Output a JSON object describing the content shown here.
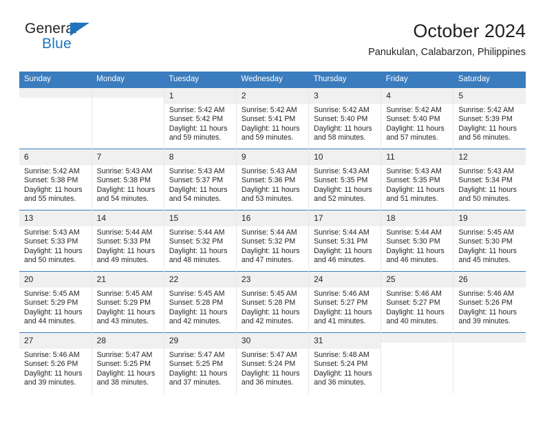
{
  "brand": {
    "name_top": "General",
    "name_bottom": "Blue",
    "triangle_color": "#1f74bd",
    "text_color": "#231f20"
  },
  "header": {
    "title": "October 2024",
    "subtitle": "Panukulan, Calabarzon, Philippines"
  },
  "calendar": {
    "header_bg": "#3a7cbe",
    "header_text_color": "#ffffff",
    "daynum_bg": "#f0f0f0",
    "weekday_headers": [
      "Sunday",
      "Monday",
      "Tuesday",
      "Wednesday",
      "Thursday",
      "Friday",
      "Saturday"
    ],
    "weeks": [
      [
        {
          "day": "",
          "sunrise": "",
          "sunset": "",
          "daylight_line1": "",
          "daylight_line2": ""
        },
        {
          "day": "",
          "sunrise": "",
          "sunset": "",
          "daylight_line1": "",
          "daylight_line2": ""
        },
        {
          "day": "1",
          "sunrise": "Sunrise: 5:42 AM",
          "sunset": "Sunset: 5:42 PM",
          "daylight_line1": "Daylight: 11 hours",
          "daylight_line2": "and 59 minutes."
        },
        {
          "day": "2",
          "sunrise": "Sunrise: 5:42 AM",
          "sunset": "Sunset: 5:41 PM",
          "daylight_line1": "Daylight: 11 hours",
          "daylight_line2": "and 59 minutes."
        },
        {
          "day": "3",
          "sunrise": "Sunrise: 5:42 AM",
          "sunset": "Sunset: 5:40 PM",
          "daylight_line1": "Daylight: 11 hours",
          "daylight_line2": "and 58 minutes."
        },
        {
          "day": "4",
          "sunrise": "Sunrise: 5:42 AM",
          "sunset": "Sunset: 5:40 PM",
          "daylight_line1": "Daylight: 11 hours",
          "daylight_line2": "and 57 minutes."
        },
        {
          "day": "5",
          "sunrise": "Sunrise: 5:42 AM",
          "sunset": "Sunset: 5:39 PM",
          "daylight_line1": "Daylight: 11 hours",
          "daylight_line2": "and 56 minutes."
        }
      ],
      [
        {
          "day": "6",
          "sunrise": "Sunrise: 5:42 AM",
          "sunset": "Sunset: 5:38 PM",
          "daylight_line1": "Daylight: 11 hours",
          "daylight_line2": "and 55 minutes."
        },
        {
          "day": "7",
          "sunrise": "Sunrise: 5:43 AM",
          "sunset": "Sunset: 5:38 PM",
          "daylight_line1": "Daylight: 11 hours",
          "daylight_line2": "and 54 minutes."
        },
        {
          "day": "8",
          "sunrise": "Sunrise: 5:43 AM",
          "sunset": "Sunset: 5:37 PM",
          "daylight_line1": "Daylight: 11 hours",
          "daylight_line2": "and 54 minutes."
        },
        {
          "day": "9",
          "sunrise": "Sunrise: 5:43 AM",
          "sunset": "Sunset: 5:36 PM",
          "daylight_line1": "Daylight: 11 hours",
          "daylight_line2": "and 53 minutes."
        },
        {
          "day": "10",
          "sunrise": "Sunrise: 5:43 AM",
          "sunset": "Sunset: 5:35 PM",
          "daylight_line1": "Daylight: 11 hours",
          "daylight_line2": "and 52 minutes."
        },
        {
          "day": "11",
          "sunrise": "Sunrise: 5:43 AM",
          "sunset": "Sunset: 5:35 PM",
          "daylight_line1": "Daylight: 11 hours",
          "daylight_line2": "and 51 minutes."
        },
        {
          "day": "12",
          "sunrise": "Sunrise: 5:43 AM",
          "sunset": "Sunset: 5:34 PM",
          "daylight_line1": "Daylight: 11 hours",
          "daylight_line2": "and 50 minutes."
        }
      ],
      [
        {
          "day": "13",
          "sunrise": "Sunrise: 5:43 AM",
          "sunset": "Sunset: 5:33 PM",
          "daylight_line1": "Daylight: 11 hours",
          "daylight_line2": "and 50 minutes."
        },
        {
          "day": "14",
          "sunrise": "Sunrise: 5:44 AM",
          "sunset": "Sunset: 5:33 PM",
          "daylight_line1": "Daylight: 11 hours",
          "daylight_line2": "and 49 minutes."
        },
        {
          "day": "15",
          "sunrise": "Sunrise: 5:44 AM",
          "sunset": "Sunset: 5:32 PM",
          "daylight_line1": "Daylight: 11 hours",
          "daylight_line2": "and 48 minutes."
        },
        {
          "day": "16",
          "sunrise": "Sunrise: 5:44 AM",
          "sunset": "Sunset: 5:32 PM",
          "daylight_line1": "Daylight: 11 hours",
          "daylight_line2": "and 47 minutes."
        },
        {
          "day": "17",
          "sunrise": "Sunrise: 5:44 AM",
          "sunset": "Sunset: 5:31 PM",
          "daylight_line1": "Daylight: 11 hours",
          "daylight_line2": "and 46 minutes."
        },
        {
          "day": "18",
          "sunrise": "Sunrise: 5:44 AM",
          "sunset": "Sunset: 5:30 PM",
          "daylight_line1": "Daylight: 11 hours",
          "daylight_line2": "and 46 minutes."
        },
        {
          "day": "19",
          "sunrise": "Sunrise: 5:45 AM",
          "sunset": "Sunset: 5:30 PM",
          "daylight_line1": "Daylight: 11 hours",
          "daylight_line2": "and 45 minutes."
        }
      ],
      [
        {
          "day": "20",
          "sunrise": "Sunrise: 5:45 AM",
          "sunset": "Sunset: 5:29 PM",
          "daylight_line1": "Daylight: 11 hours",
          "daylight_line2": "and 44 minutes."
        },
        {
          "day": "21",
          "sunrise": "Sunrise: 5:45 AM",
          "sunset": "Sunset: 5:29 PM",
          "daylight_line1": "Daylight: 11 hours",
          "daylight_line2": "and 43 minutes."
        },
        {
          "day": "22",
          "sunrise": "Sunrise: 5:45 AM",
          "sunset": "Sunset: 5:28 PM",
          "daylight_line1": "Daylight: 11 hours",
          "daylight_line2": "and 42 minutes."
        },
        {
          "day": "23",
          "sunrise": "Sunrise: 5:45 AM",
          "sunset": "Sunset: 5:28 PM",
          "daylight_line1": "Daylight: 11 hours",
          "daylight_line2": "and 42 minutes."
        },
        {
          "day": "24",
          "sunrise": "Sunrise: 5:46 AM",
          "sunset": "Sunset: 5:27 PM",
          "daylight_line1": "Daylight: 11 hours",
          "daylight_line2": "and 41 minutes."
        },
        {
          "day": "25",
          "sunrise": "Sunrise: 5:46 AM",
          "sunset": "Sunset: 5:27 PM",
          "daylight_line1": "Daylight: 11 hours",
          "daylight_line2": "and 40 minutes."
        },
        {
          "day": "26",
          "sunrise": "Sunrise: 5:46 AM",
          "sunset": "Sunset: 5:26 PM",
          "daylight_line1": "Daylight: 11 hours",
          "daylight_line2": "and 39 minutes."
        }
      ],
      [
        {
          "day": "27",
          "sunrise": "Sunrise: 5:46 AM",
          "sunset": "Sunset: 5:26 PM",
          "daylight_line1": "Daylight: 11 hours",
          "daylight_line2": "and 39 minutes."
        },
        {
          "day": "28",
          "sunrise": "Sunrise: 5:47 AM",
          "sunset": "Sunset: 5:25 PM",
          "daylight_line1": "Daylight: 11 hours",
          "daylight_line2": "and 38 minutes."
        },
        {
          "day": "29",
          "sunrise": "Sunrise: 5:47 AM",
          "sunset": "Sunset: 5:25 PM",
          "daylight_line1": "Daylight: 11 hours",
          "daylight_line2": "and 37 minutes."
        },
        {
          "day": "30",
          "sunrise": "Sunrise: 5:47 AM",
          "sunset": "Sunset: 5:24 PM",
          "daylight_line1": "Daylight: 11 hours",
          "daylight_line2": "and 36 minutes."
        },
        {
          "day": "31",
          "sunrise": "Sunrise: 5:48 AM",
          "sunset": "Sunset: 5:24 PM",
          "daylight_line1": "Daylight: 11 hours",
          "daylight_line2": "and 36 minutes."
        },
        {
          "day": "",
          "sunrise": "",
          "sunset": "",
          "daylight_line1": "",
          "daylight_line2": ""
        },
        {
          "day": "",
          "sunrise": "",
          "sunset": "",
          "daylight_line1": "",
          "daylight_line2": ""
        }
      ]
    ]
  }
}
